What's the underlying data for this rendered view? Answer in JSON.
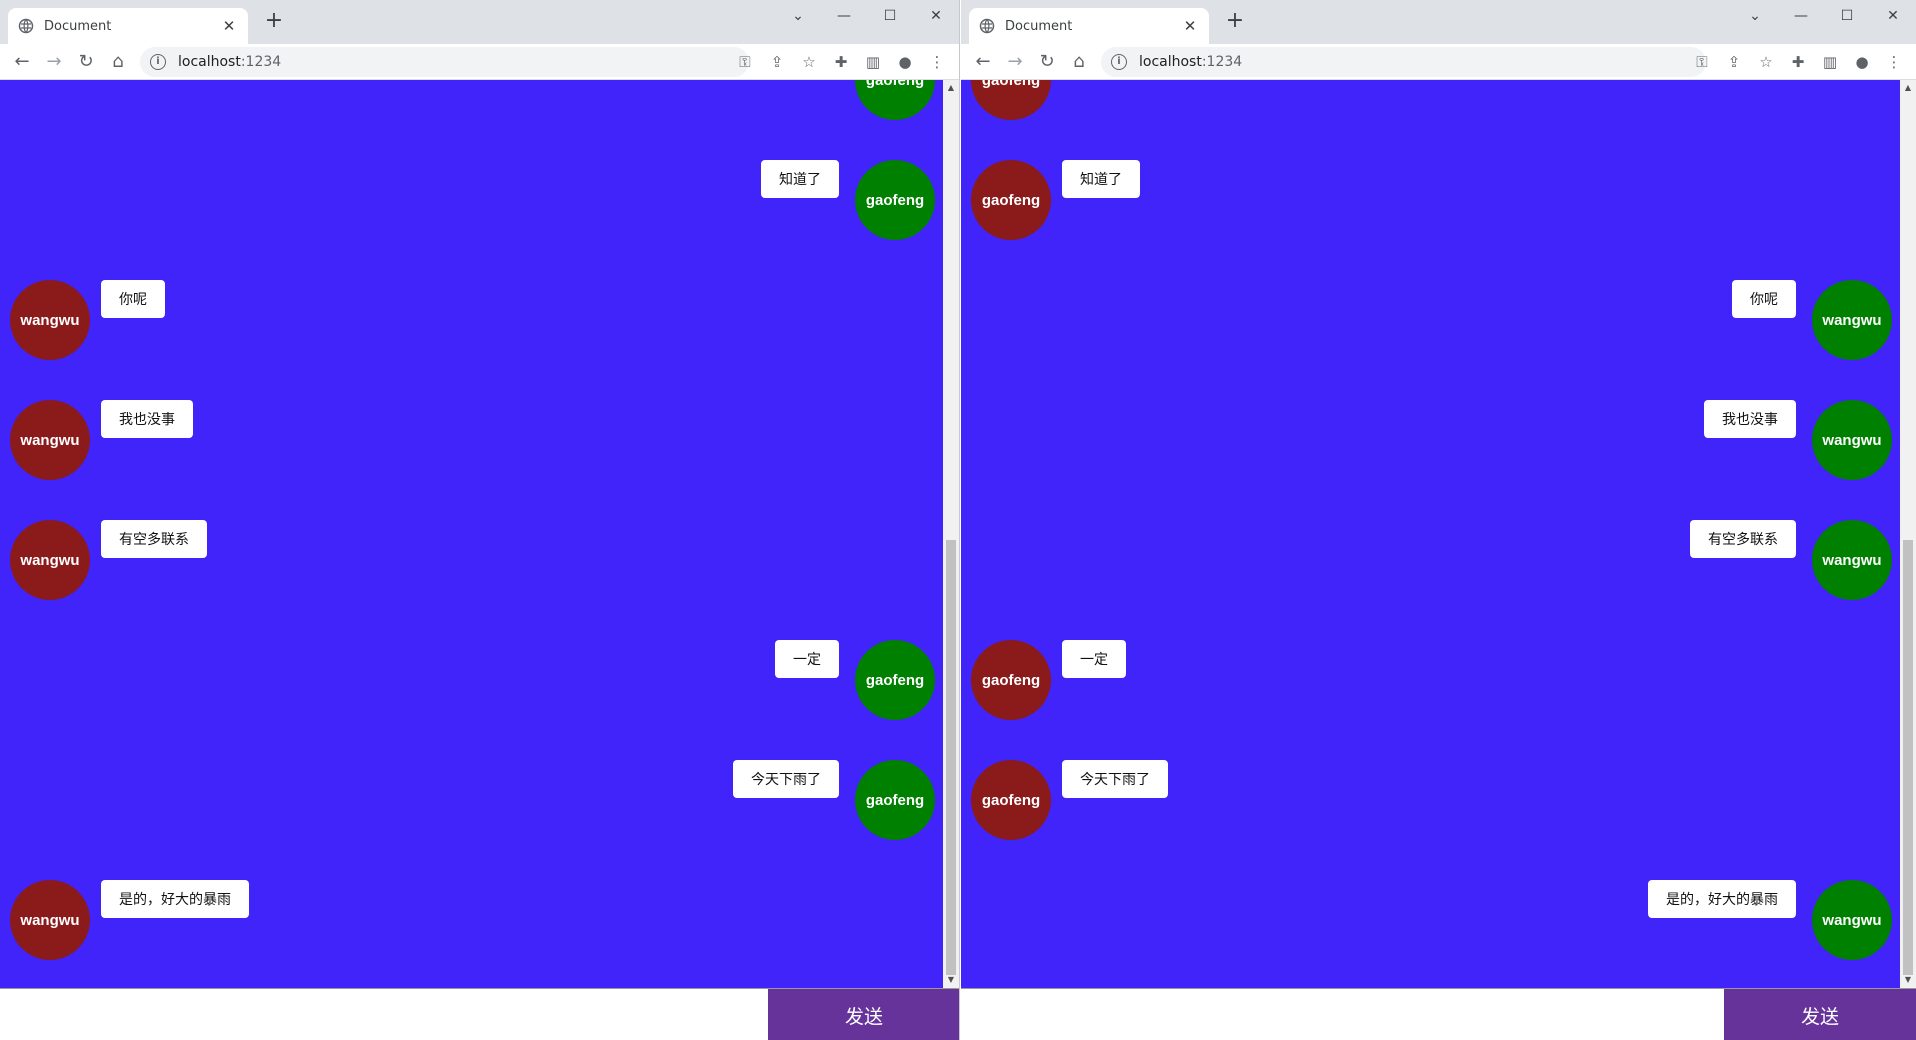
{
  "browser": {
    "tab_title": "Document",
    "url_host": "localhost",
    "url_port": ":1234"
  },
  "colors": {
    "chat_bg": "#4124fa",
    "self_avatar": "#008000",
    "other_avatar": "#8b1a1a",
    "send_button": "#66339a"
  },
  "left_window": {
    "messages": [
      {
        "user": "gaofeng",
        "text": "",
        "side": "right"
      },
      {
        "user": "gaofeng",
        "text": "知道了",
        "side": "right"
      },
      {
        "user": "wangwu",
        "text": "你呢",
        "side": "left"
      },
      {
        "user": "wangwu",
        "text": "我也没事",
        "side": "left"
      },
      {
        "user": "wangwu",
        "text": "有空多联系",
        "side": "left"
      },
      {
        "user": "gaofeng",
        "text": "一定",
        "side": "right"
      },
      {
        "user": "gaofeng",
        "text": "今天下雨了",
        "side": "right"
      },
      {
        "user": "wangwu",
        "text": "是的，好大的暴雨",
        "side": "left"
      }
    ],
    "input_value": "",
    "send_label": "发送"
  },
  "right_window": {
    "messages": [
      {
        "user": "gaofeng",
        "text": "",
        "side": "left"
      },
      {
        "user": "gaofeng",
        "text": "知道了",
        "side": "left"
      },
      {
        "user": "wangwu",
        "text": "你呢",
        "side": "right"
      },
      {
        "user": "wangwu",
        "text": "我也没事",
        "side": "right"
      },
      {
        "user": "wangwu",
        "text": "有空多联系",
        "side": "right"
      },
      {
        "user": "gaofeng",
        "text": "一定",
        "side": "left"
      },
      {
        "user": "gaofeng",
        "text": "今天下雨了",
        "side": "left"
      },
      {
        "user": "wangwu",
        "text": "是的，好大的暴雨",
        "side": "right"
      }
    ],
    "input_value": "",
    "send_label": "发送"
  }
}
